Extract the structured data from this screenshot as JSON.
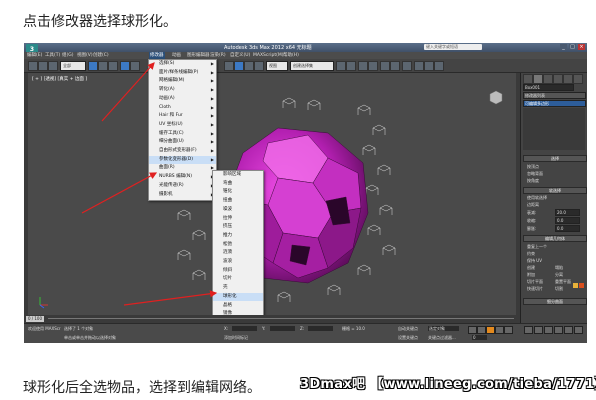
{
  "captions": {
    "top": "点击修改器选择球形化。",
    "bottom": "球形化后全选物品，选择到编辑网络。",
    "watermark": "3Dmax吧 【www.lineeg.com/tieba/1771】"
  },
  "window": {
    "logo": "3",
    "title": "Autodesk 3ds Max 2012 x64    无标题",
    "search_placeholder": "键入关键字或短语",
    "minimize": "_",
    "maximize": "□",
    "close": "×"
  },
  "menubar": {
    "items": [
      {
        "label": "编辑(E)",
        "active": false
      },
      {
        "label": "工具(T)",
        "active": false
      },
      {
        "label": "组(G)",
        "active": false
      },
      {
        "label": "视图(V)",
        "active": false
      },
      {
        "label": "创建(C)",
        "active": false
      },
      {
        "label": "修改器",
        "active": true
      },
      {
        "label": "动画",
        "active": false
      },
      {
        "label": "图形编辑器",
        "active": false
      },
      {
        "label": "渲染(R)",
        "active": false
      },
      {
        "label": "自定义(U)",
        "active": false
      },
      {
        "label": "MAXScript(M)",
        "active": false
      },
      {
        "label": "帮助(H)",
        "active": false
      }
    ]
  },
  "toolbar": {
    "selection_filter": "全部",
    "view_dropdown": "视图",
    "named_selection": "创建选择集"
  },
  "viewport": {
    "label": "[ + ] [透视] [真实 + 边面 ]"
  },
  "modifiers_menu": {
    "items": [
      {
        "label": "选择(S)",
        "submenu": true
      },
      {
        "label": "面片/样条线编辑(P)",
        "submenu": true
      },
      {
        "label": "网格编辑(M)",
        "submenu": true
      },
      {
        "label": "转化(A)",
        "submenu": true
      },
      {
        "label": "动画(A)",
        "submenu": true
      },
      {
        "label": "Cloth",
        "submenu": true
      },
      {
        "label": "Hair 和 Fur",
        "submenu": true
      },
      {
        "label": "UV 坐标(U)",
        "submenu": true
      },
      {
        "label": "缓存工具(C)",
        "submenu": true
      },
      {
        "label": "细分曲面(U)",
        "submenu": true
      },
      {
        "label": "自由形式变形器(F)",
        "submenu": true
      },
      {
        "label": "参数化变形器(D)",
        "submenu": true,
        "highlighted": true
      },
      {
        "label": "曲面(R)",
        "submenu": true
      },
      {
        "label": "NURBS 编辑(N)",
        "submenu": true
      },
      {
        "label": "光能传递(R)",
        "submenu": true
      },
      {
        "label": "摄影机",
        "submenu": true
      }
    ]
  },
  "parametric_submenu": {
    "items": [
      {
        "label": "影响区域"
      },
      {
        "label": "弯曲"
      },
      {
        "label": "锥化"
      },
      {
        "label": "扭曲"
      },
      {
        "label": "噪波"
      },
      {
        "label": "拉伸"
      },
      {
        "label": "挤压"
      },
      {
        "label": "推力"
      },
      {
        "label": "松弛"
      },
      {
        "label": "涟漪"
      },
      {
        "label": "波浪"
      },
      {
        "label": "倾斜"
      },
      {
        "label": "切片"
      },
      {
        "label": "壳"
      },
      {
        "label": "球形化",
        "highlighted": true
      },
      {
        "label": "晶格"
      },
      {
        "label": "镜像"
      },
      {
        "label": "置换"
      },
      {
        "label": "XForm"
      },
      {
        "label": "替换"
      },
      {
        "label": "保留"
      },
      {
        "label": "融化"
      },
      {
        "label": "FFD"
      }
    ]
  },
  "command_panel": {
    "object_name": "Box001",
    "modifier_list": "修改器列表",
    "modifier_stack_item": "可编辑多边形",
    "selection_rollout": "选择",
    "by_vertex": "按顶点",
    "ignore_backfacing": "忽略背面",
    "by_angle": "按角度",
    "soft_selection": "软选择",
    "use_soft_selection": "使用软选择",
    "edge_distance": "边距离",
    "falloff_label": "衰减:",
    "falloff_value": "20.0",
    "pinch_label": "收缩:",
    "pinch_value": "0.0",
    "bubble_label": "膨胀:",
    "bubble_value": "0.0",
    "edit_geometry": "编辑几何体",
    "repeat_last": "重复上一个",
    "constraints": "约束",
    "preserve_uvs": "保持 UV",
    "create": "创建",
    "collapse": "塌陷",
    "attach": "附加",
    "detach": "分离",
    "slice_plane": "切片平面",
    "reset_plane": "重置平面",
    "quickslice": "快速切片",
    "cut": "切割",
    "subdivision_surface": "细分曲面"
  },
  "timeline": {
    "frame_display": "0 / 100"
  },
  "statusbar": {
    "selected_text": "选择了 1 个对象",
    "prompt_text": "单击或单击并拖动以选择对象",
    "welcome": "欢迎使用 MAXScr",
    "x_label": "X:",
    "y_label": "Y:",
    "z_label": "Z:",
    "grid": "栅格 = 10.0",
    "autokey": "自动关键点",
    "setkey": "设置关键点",
    "selected_dropdown": "选定对象",
    "key_filters": "关键点过滤器...",
    "add_time_tag": "添加时间标记",
    "frame_value": "0"
  }
}
